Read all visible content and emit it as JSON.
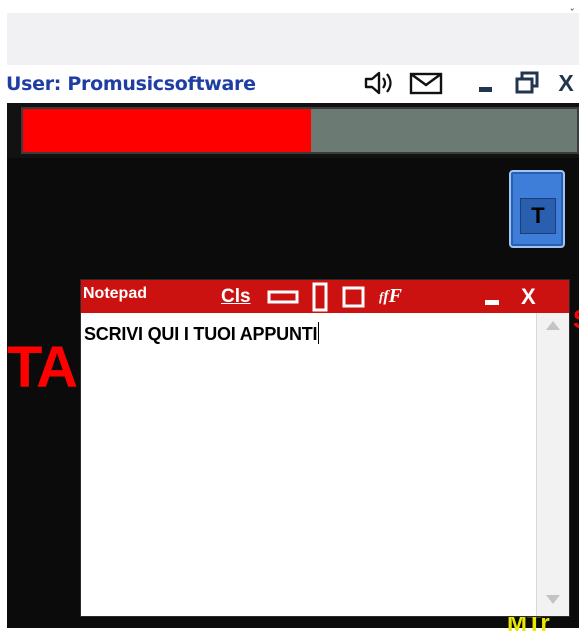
{
  "header": {
    "user_label": "User: Promusicsoftware"
  },
  "window_controls": {
    "speaker_icon": "speaker-icon",
    "mail_icon": "mail-icon",
    "minimize": "minimize-icon",
    "restore": "restore-icon",
    "close": "X"
  },
  "progress": {
    "value_fraction": 0.52,
    "fill_color": "#ff0000",
    "track_color": "#6c7a74"
  },
  "t_button": {
    "label": "T"
  },
  "background": {
    "red_text": "TA",
    "red_right_glyph": "S",
    "yellow_text": "MTr"
  },
  "notepad": {
    "title": "Notepad",
    "cls_label": "Cls",
    "font_label": "ffF",
    "close_label": "X",
    "content": "SCRIVI QUI I TUOI APPUNTI"
  },
  "colors": {
    "titlebar_red": "#cc1111",
    "user_blue": "#1f3ea3",
    "accent_blue": "#3f7ed8"
  }
}
